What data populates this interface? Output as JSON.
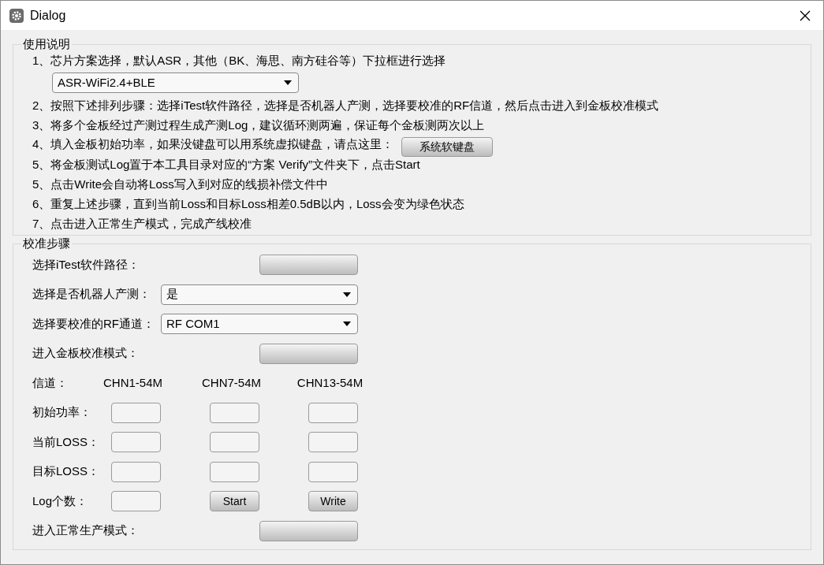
{
  "window": {
    "title": "Dialog"
  },
  "instructions": {
    "title": "使用说明",
    "lines": [
      {
        "kind": "text",
        "text": "1、芯片方案选择，默认ASR，其他（BK、海思、南方硅谷等）下拉框进行选择"
      },
      {
        "kind": "select",
        "value": "ASR-WiFi2.4+BLE"
      },
      {
        "kind": "text",
        "text": "2、按照下述排列步骤：选择iTest软件路径，选择是否机器人产测，选择要校准的RF信道，然后点击进入到金板校准模式"
      },
      {
        "kind": "text",
        "text": "3、将多个金板经过产测过程生成产测Log，建议循环测两遍，保证每个金板测两次以上"
      },
      {
        "kind": "text_button",
        "text": "4、填入金板初始功率，如果没键盘可以用系统虚拟键盘，请点这里：",
        "button": "系统软键盘"
      },
      {
        "kind": "text",
        "text": "5、将金板测试Log置于本工具目录对应的“方案 Verify”文件夹下，点击Start"
      },
      {
        "kind": "text",
        "text": "5、点击Write会自动将Loss写入到对应的线损补偿文件中"
      },
      {
        "kind": "text",
        "text": "6、重复上述步骤，直到当前Loss和目标Loss相差0.5dB以内，Loss会变为绿色状态"
      },
      {
        "kind": "text",
        "text": "7、点击进入正常生产模式，完成产线校准"
      }
    ]
  },
  "calibration": {
    "title": "校准步骤",
    "rows": [
      {
        "kind": "button",
        "label": "选择iTest软件路径："
      },
      {
        "kind": "select",
        "label": "选择是否机器人产测：",
        "value": "是"
      },
      {
        "kind": "select",
        "label": "选择要校准的RF通道：",
        "value": "RF COM1"
      },
      {
        "kind": "button",
        "label": "进入金板校准模式："
      },
      {
        "kind": "channels",
        "label": "信道：",
        "headers": [
          "CHN1-54M",
          "CHN7-54M",
          "CHN13-54M"
        ]
      },
      {
        "kind": "inputs",
        "label": "初始功率："
      },
      {
        "kind": "inputs",
        "label": "当前LOSS："
      },
      {
        "kind": "inputs",
        "label": "目标LOSS："
      },
      {
        "kind": "log",
        "label": "Log个数：",
        "buttons": [
          "Start",
          "Write"
        ]
      },
      {
        "kind": "button",
        "label": "进入正常生产模式："
      }
    ]
  }
}
